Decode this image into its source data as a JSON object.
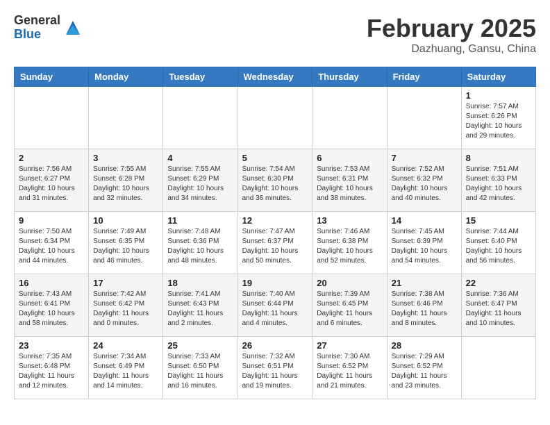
{
  "header": {
    "logo_general": "General",
    "logo_blue": "Blue",
    "month_year": "February 2025",
    "location": "Dazhuang, Gansu, China"
  },
  "calendar": {
    "headers": [
      "Sunday",
      "Monday",
      "Tuesday",
      "Wednesday",
      "Thursday",
      "Friday",
      "Saturday"
    ],
    "weeks": [
      [
        {
          "day": "",
          "info": ""
        },
        {
          "day": "",
          "info": ""
        },
        {
          "day": "",
          "info": ""
        },
        {
          "day": "",
          "info": ""
        },
        {
          "day": "",
          "info": ""
        },
        {
          "day": "",
          "info": ""
        },
        {
          "day": "1",
          "info": "Sunrise: 7:57 AM\nSunset: 6:26 PM\nDaylight: 10 hours\nand 29 minutes."
        }
      ],
      [
        {
          "day": "2",
          "info": "Sunrise: 7:56 AM\nSunset: 6:27 PM\nDaylight: 10 hours\nand 31 minutes."
        },
        {
          "day": "3",
          "info": "Sunrise: 7:55 AM\nSunset: 6:28 PM\nDaylight: 10 hours\nand 32 minutes."
        },
        {
          "day": "4",
          "info": "Sunrise: 7:55 AM\nSunset: 6:29 PM\nDaylight: 10 hours\nand 34 minutes."
        },
        {
          "day": "5",
          "info": "Sunrise: 7:54 AM\nSunset: 6:30 PM\nDaylight: 10 hours\nand 36 minutes."
        },
        {
          "day": "6",
          "info": "Sunrise: 7:53 AM\nSunset: 6:31 PM\nDaylight: 10 hours\nand 38 minutes."
        },
        {
          "day": "7",
          "info": "Sunrise: 7:52 AM\nSunset: 6:32 PM\nDaylight: 10 hours\nand 40 minutes."
        },
        {
          "day": "8",
          "info": "Sunrise: 7:51 AM\nSunset: 6:33 PM\nDaylight: 10 hours\nand 42 minutes."
        }
      ],
      [
        {
          "day": "9",
          "info": "Sunrise: 7:50 AM\nSunset: 6:34 PM\nDaylight: 10 hours\nand 44 minutes."
        },
        {
          "day": "10",
          "info": "Sunrise: 7:49 AM\nSunset: 6:35 PM\nDaylight: 10 hours\nand 46 minutes."
        },
        {
          "day": "11",
          "info": "Sunrise: 7:48 AM\nSunset: 6:36 PM\nDaylight: 10 hours\nand 48 minutes."
        },
        {
          "day": "12",
          "info": "Sunrise: 7:47 AM\nSunset: 6:37 PM\nDaylight: 10 hours\nand 50 minutes."
        },
        {
          "day": "13",
          "info": "Sunrise: 7:46 AM\nSunset: 6:38 PM\nDaylight: 10 hours\nand 52 minutes."
        },
        {
          "day": "14",
          "info": "Sunrise: 7:45 AM\nSunset: 6:39 PM\nDaylight: 10 hours\nand 54 minutes."
        },
        {
          "day": "15",
          "info": "Sunrise: 7:44 AM\nSunset: 6:40 PM\nDaylight: 10 hours\nand 56 minutes."
        }
      ],
      [
        {
          "day": "16",
          "info": "Sunrise: 7:43 AM\nSunset: 6:41 PM\nDaylight: 10 hours\nand 58 minutes."
        },
        {
          "day": "17",
          "info": "Sunrise: 7:42 AM\nSunset: 6:42 PM\nDaylight: 11 hours\nand 0 minutes."
        },
        {
          "day": "18",
          "info": "Sunrise: 7:41 AM\nSunset: 6:43 PM\nDaylight: 11 hours\nand 2 minutes."
        },
        {
          "day": "19",
          "info": "Sunrise: 7:40 AM\nSunset: 6:44 PM\nDaylight: 11 hours\nand 4 minutes."
        },
        {
          "day": "20",
          "info": "Sunrise: 7:39 AM\nSunset: 6:45 PM\nDaylight: 11 hours\nand 6 minutes."
        },
        {
          "day": "21",
          "info": "Sunrise: 7:38 AM\nSunset: 6:46 PM\nDaylight: 11 hours\nand 8 minutes."
        },
        {
          "day": "22",
          "info": "Sunrise: 7:36 AM\nSunset: 6:47 PM\nDaylight: 11 hours\nand 10 minutes."
        }
      ],
      [
        {
          "day": "23",
          "info": "Sunrise: 7:35 AM\nSunset: 6:48 PM\nDaylight: 11 hours\nand 12 minutes."
        },
        {
          "day": "24",
          "info": "Sunrise: 7:34 AM\nSunset: 6:49 PM\nDaylight: 11 hours\nand 14 minutes."
        },
        {
          "day": "25",
          "info": "Sunrise: 7:33 AM\nSunset: 6:50 PM\nDaylight: 11 hours\nand 16 minutes."
        },
        {
          "day": "26",
          "info": "Sunrise: 7:32 AM\nSunset: 6:51 PM\nDaylight: 11 hours\nand 19 minutes."
        },
        {
          "day": "27",
          "info": "Sunrise: 7:30 AM\nSunset: 6:52 PM\nDaylight: 11 hours\nand 21 minutes."
        },
        {
          "day": "28",
          "info": "Sunrise: 7:29 AM\nSunset: 6:52 PM\nDaylight: 11 hours\nand 23 minutes."
        },
        {
          "day": "",
          "info": ""
        }
      ]
    ]
  }
}
